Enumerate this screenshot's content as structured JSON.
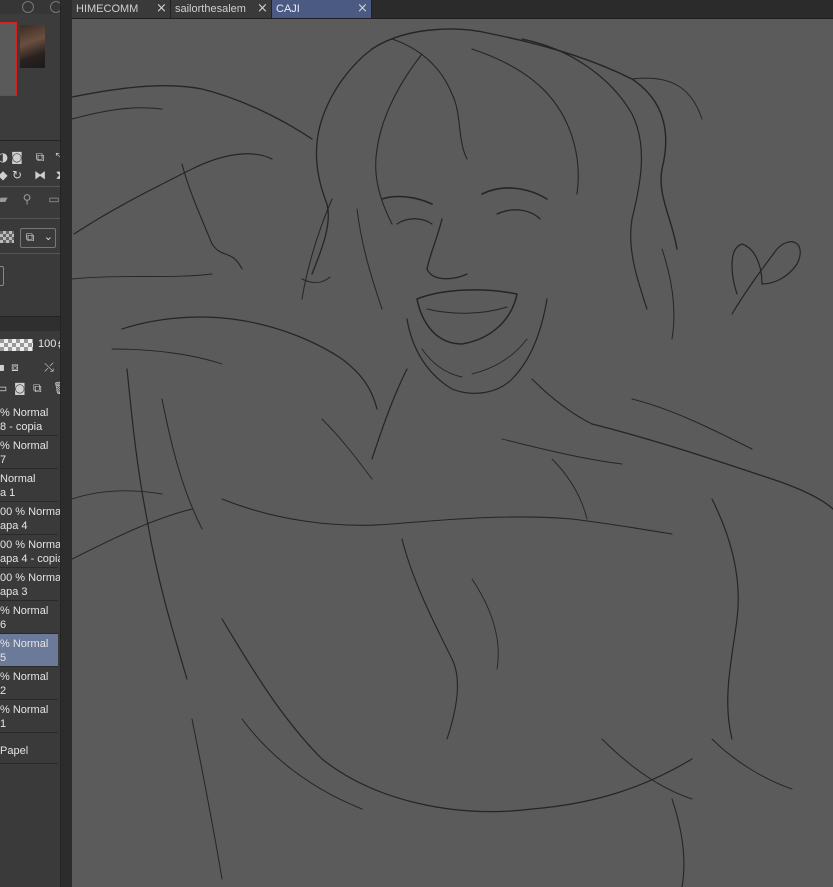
{
  "tabs": [
    {
      "label": "HIMECOMM",
      "close": "×",
      "active": false
    },
    {
      "label": "sailorthesalem",
      "close": "×",
      "active": false
    },
    {
      "label": "CAJI",
      "close": "×",
      "active": true
    }
  ],
  "layer_panel": {
    "opacity_value": "100",
    "layers": [
      {
        "line1": "% Normal",
        "line2": "8 - copia",
        "selected": false
      },
      {
        "line1": "% Normal",
        "line2": "7",
        "selected": false
      },
      {
        "line1": "Normal",
        "line2": "a 1",
        "selected": false
      },
      {
        "line1": "00 % Normal",
        "line2": "apa 4",
        "selected": false
      },
      {
        "line1": "00 % Normal",
        "line2": "apa 4 - copia",
        "selected": false
      },
      {
        "line1": "00 % Normal",
        "line2": "apa 3",
        "selected": false
      },
      {
        "line1": "% Normal",
        "line2": "6",
        "selected": false
      },
      {
        "line1": "% Normal",
        "line2": "5",
        "selected": true
      },
      {
        "line1": "% Normal",
        "line2": "2",
        "selected": false
      },
      {
        "line1": "% Normal",
        "line2": "1",
        "selected": false
      }
    ],
    "paper_label": "Papel"
  },
  "colors": {
    "active_tab": "#4a5a82",
    "selected_layer": "#6c7a99",
    "canvas": "#5b5b5b",
    "navigator_frame": "#d62020"
  },
  "icons": [
    "rotate-icon",
    "stop-icon",
    "layers-icon",
    "fit-icon",
    "flip-horizontal-icon",
    "flip-vertical-icon",
    "trash-icon",
    "mask-icon",
    "checker-icon"
  ]
}
